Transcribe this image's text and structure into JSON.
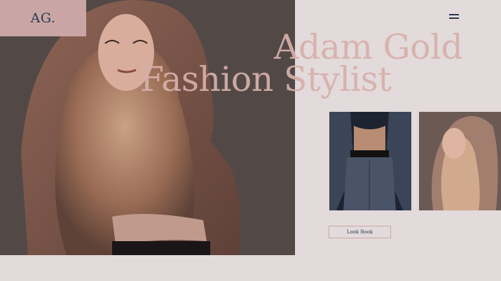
{
  "header": {
    "logo_text": "AG.",
    "menu_icon": "hamburger-menu-icon"
  },
  "hero": {
    "title_line1": "Adam Gold",
    "title_line2": "Fashion Stylist",
    "image": "model-in-pink-hood-photo"
  },
  "gallery": {
    "images": [
      "model-grey-suit-photo",
      "model-pink-hood-profile-photo"
    ]
  },
  "cta": {
    "look_book_label": "Look Book"
  },
  "colors": {
    "page_background": "#e3dadb",
    "accent_pink": "#c9a6a3",
    "title_pink": "#d6afaa",
    "navy": "#2a3a55"
  }
}
